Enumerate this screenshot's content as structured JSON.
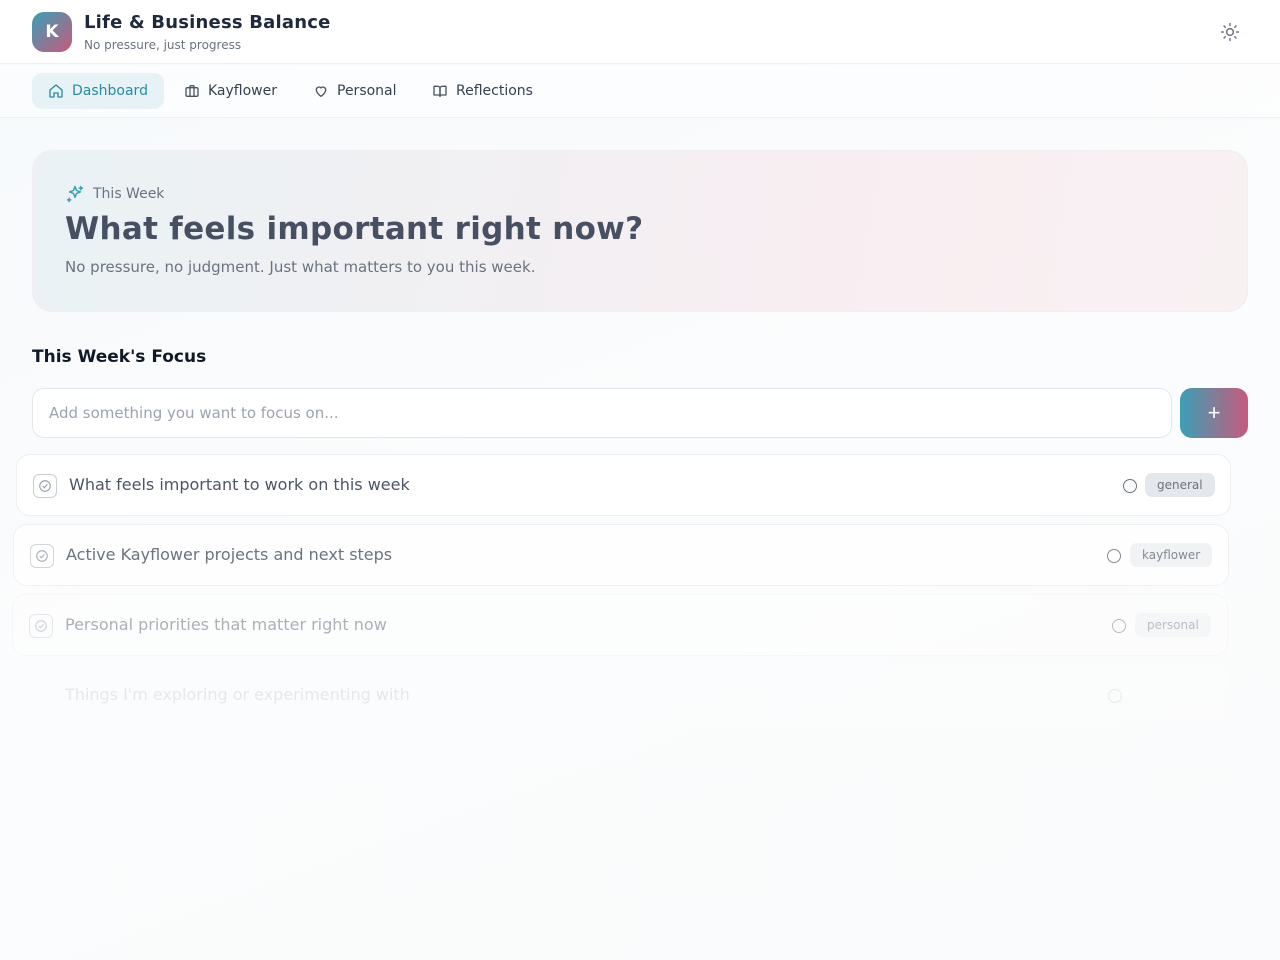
{
  "header": {
    "logo_letter": "K",
    "title": "Life & Business Balance",
    "subtitle": "No pressure, just progress",
    "theme_icon": "sun-icon"
  },
  "nav": {
    "tabs": [
      {
        "label": "Dashboard",
        "icon": "home-icon",
        "active": true
      },
      {
        "label": "Kayflower",
        "icon": "briefcase-icon",
        "active": false
      },
      {
        "label": "Personal",
        "icon": "heart-icon",
        "active": false
      },
      {
        "label": "Reflections",
        "icon": "book-icon",
        "active": false
      }
    ]
  },
  "hero": {
    "eyebrow": "This Week",
    "eyebrow_icon": "sparkles-icon",
    "title": "What feels important right now?",
    "description": "No pressure, no judgment. Just what matters to you this week."
  },
  "focus": {
    "section_title": "This Week's Focus",
    "input_placeholder": "Add something you want to focus on...",
    "input_value": "",
    "add_button": "+",
    "items": [
      {
        "label": "What feels important to work on this week",
        "tag": "general"
      },
      {
        "label": "Active Kayflower projects and next steps",
        "tag": "kayflower"
      },
      {
        "label": "Personal priorities that matter right now",
        "tag": "personal"
      },
      {
        "label": "Things I'm exploring or experimenting with",
        "tag": ""
      }
    ]
  },
  "colors": {
    "accent_teal": "#3b9fb5",
    "accent_rose": "#c75a7d",
    "active_tab_bg": "#e6f2f6",
    "active_tab_text": "#2a8aa3"
  }
}
